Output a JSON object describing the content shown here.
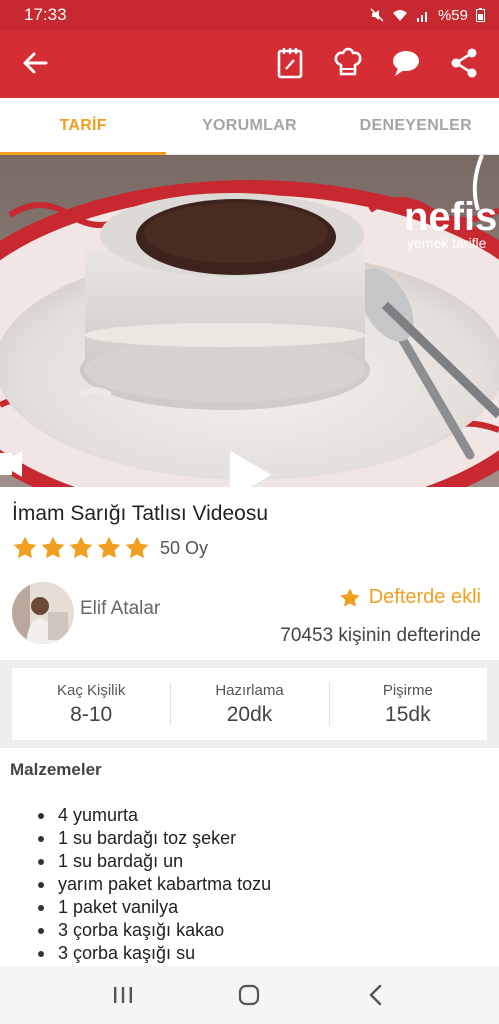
{
  "status": {
    "time": "17:33",
    "battery": "%59"
  },
  "appbar": {
    "back_icon": "arrow-back-icon",
    "actions": [
      "notebook-icon",
      "chef-hat-icon",
      "chat-bubble-icon",
      "share-icon"
    ]
  },
  "tabs": [
    {
      "label": "TARİF",
      "active": true
    },
    {
      "label": "YORUMLAR",
      "active": false
    },
    {
      "label": "DENEYENLER",
      "active": false
    }
  ],
  "video": {
    "watermark": "nefis",
    "watermark_sub": "yemek tarifle"
  },
  "recipe": {
    "title": "İmam Sarığı Tatlısı Videosu",
    "stars": 5,
    "votes": "50 Oy"
  },
  "author": {
    "name": "Elif Atalar",
    "saved_label": "Defterde ekli",
    "saved_count": "70453 kişinin defterinde"
  },
  "info": [
    {
      "label": "Kaç Kişilik",
      "value": "8-10"
    },
    {
      "label": "Hazırlama",
      "value": "20dk"
    },
    {
      "label": "Pişirme",
      "value": "15dk"
    }
  ],
  "ingredients": {
    "title": "Malzemeler",
    "items": [
      "4 yumurta",
      "1 su bardağı toz şeker",
      "1 su bardağı un",
      "yarım paket kabartma tozu",
      "1 paket vanilya",
      "3 çorba kaşığı kakao",
      "3 çorba kaşığı su"
    ]
  },
  "colors": {
    "primary": "#d42d33",
    "accent": "#f0a020"
  }
}
